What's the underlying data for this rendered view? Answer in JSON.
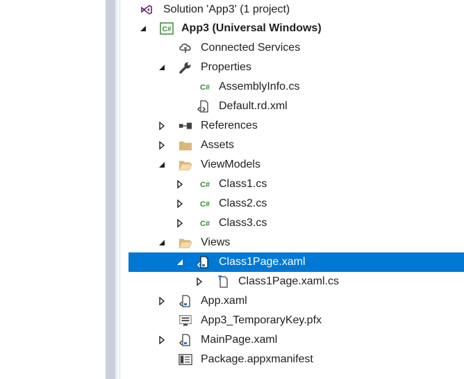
{
  "solution_explorer": {
    "solution_label": "Solution 'App3' (1 project)",
    "project_label": "App3 (Universal Windows)",
    "items": [
      {
        "label": "Connected Services"
      },
      {
        "label": "Properties"
      },
      {
        "label": "AssemblyInfo.cs"
      },
      {
        "label": "Default.rd.xml"
      },
      {
        "label": "References"
      },
      {
        "label": "Assets"
      },
      {
        "label": "ViewModels"
      },
      {
        "label": "Class1.cs"
      },
      {
        "label": "Class2.cs"
      },
      {
        "label": "Class3.cs"
      },
      {
        "label": "Views"
      },
      {
        "label": "Class1Page.xaml"
      },
      {
        "label": "Class1Page.xaml.cs"
      },
      {
        "label": "App.xaml"
      },
      {
        "label": "App3_TemporaryKey.pfx"
      },
      {
        "label": "MainPage.xaml"
      },
      {
        "label": "Package.appxmanifest"
      }
    ]
  },
  "colors": {
    "selection": "#0078d4",
    "folder": "#dcb67a",
    "csharp": "#388a34",
    "vs_purple": "#68217a"
  }
}
